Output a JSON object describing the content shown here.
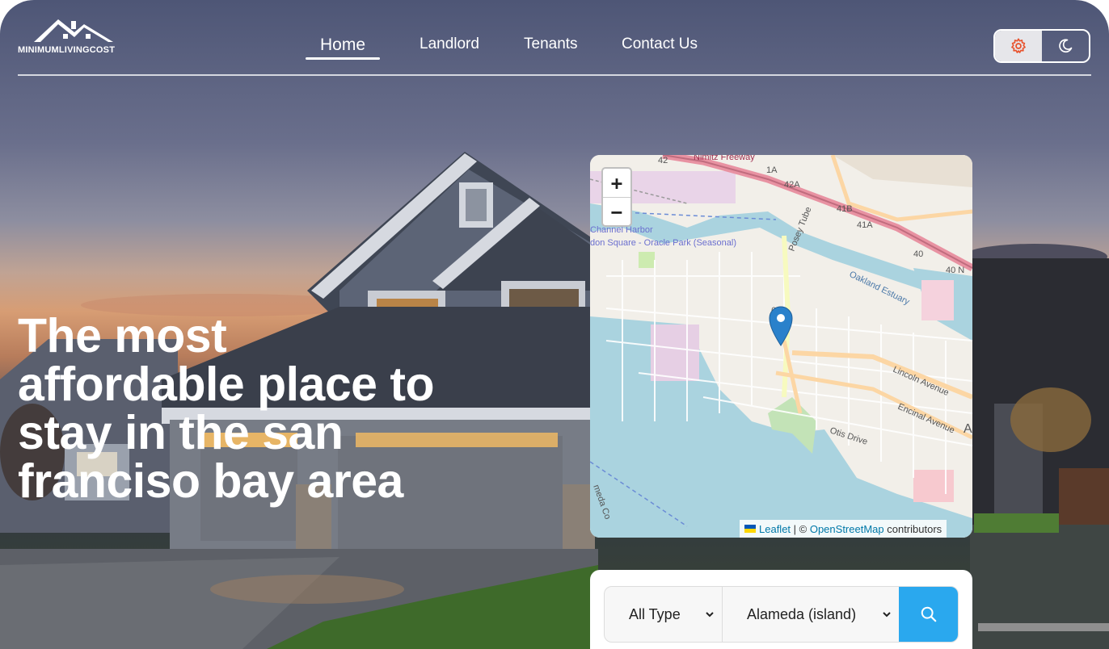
{
  "brand": {
    "logo_text": "MINIMUMLIVINGCOST"
  },
  "nav": {
    "home": "Home",
    "landlord": "Landlord",
    "tenants": "Tenants",
    "contact": "Contact Us"
  },
  "theme_toggle": {
    "light_icon": "gear-icon",
    "dark_icon": "moon-icon",
    "active": "light"
  },
  "hero": {
    "headline": "The most affordable place to stay in the san franciso bay area"
  },
  "map": {
    "zoom_in": "+",
    "zoom_out": "−",
    "attribution": {
      "leaflet": "Leaflet",
      "separator": " | © ",
      "osm": "OpenStreetMap",
      "suffix": " contributors"
    },
    "labels": {
      "hwy_42": "42",
      "hwy_42a": "42A",
      "hwy_41b": "41B",
      "hwy_41a": "41A",
      "hwy_40": "40",
      "hwy_40n": "40 N",
      "nimitz": "Nimitz Freeway",
      "harbor": "Channel Harbor",
      "oracle": "don Square - Oracle Park (Seasonal)",
      "posey": "Posey Tube",
      "estuary": "Oakland Estuary",
      "route_61": "61",
      "lincoln": "Lincoln Avenue",
      "encinal": "Encinal Avenue",
      "otis": "Otis Drive",
      "edge_a": "A",
      "alameda_co": "meda Co",
      "hwy_1a": "1A"
    },
    "marker": "map-pin-icon"
  },
  "search": {
    "type_value": "All Type",
    "city_value": "Alameda (island)",
    "button_icon": "search-icon"
  },
  "colors": {
    "accent": "#2aa8ee",
    "gear": "#e8532e",
    "water": "#aad3df"
  }
}
